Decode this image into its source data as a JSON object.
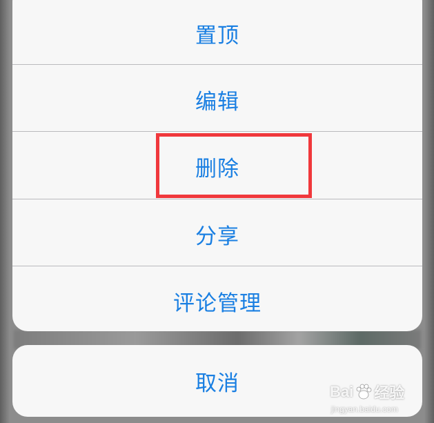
{
  "action_sheet": {
    "items": [
      {
        "label": "置顶"
      },
      {
        "label": "编辑"
      },
      {
        "label": "删除"
      },
      {
        "label": "分享"
      },
      {
        "label": "评论管理"
      }
    ],
    "cancel_label": "取消"
  },
  "watermark": {
    "brand_a": "Bai",
    "brand_b": "经验",
    "url": "jingyan.baidu.com"
  },
  "colors": {
    "action_text": "#1a7fe2",
    "sheet_bg": "#f7f7f7",
    "highlight_border": "#f0383c"
  }
}
